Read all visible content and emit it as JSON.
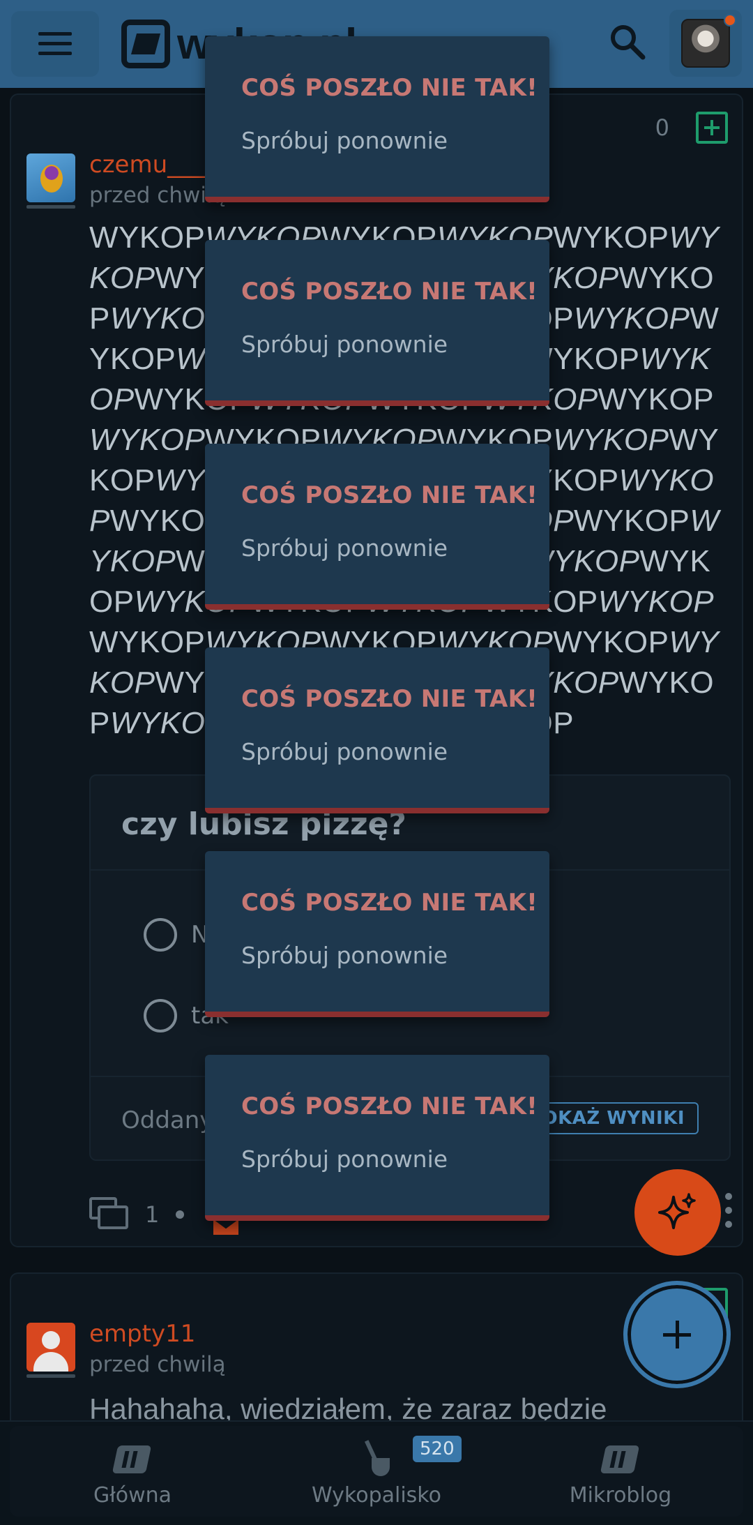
{
  "header": {
    "logo_text": "wykop.pl",
    "avatar_alt": "user-avatar"
  },
  "entries": [
    {
      "author": "czemu____",
      "time": "przed chwilą",
      "votes": "0",
      "text_segments": [
        {
          "t": "WYKOP",
          "i": false
        },
        {
          "t": "WYKOP",
          "i": true
        },
        {
          "t": "WYKOP",
          "i": false
        },
        {
          "t": "WYKOP",
          "i": true
        },
        {
          "t": "WYKOP",
          "i": false
        },
        {
          "t": "WYKOP",
          "i": true
        },
        {
          "t": "WYKOP",
          "i": false
        },
        {
          "t": "WYKOP",
          "i": true
        },
        {
          "t": "WYKOP",
          "i": false
        },
        {
          "t": "WYKOP",
          "i": true
        },
        {
          "t": "WYKOP",
          "i": false
        },
        {
          "t": "WYKOP",
          "i": true
        },
        {
          "t": "WYKOP",
          "i": false
        },
        {
          "t": "WYKOP",
          "i": true
        },
        {
          "t": "WYKOP",
          "i": false
        },
        {
          "t": "WYKOP",
          "i": true
        },
        {
          "t": "WYKOP",
          "i": false
        },
        {
          "t": "WYKOP",
          "i": true
        },
        {
          "t": "WYKOP",
          "i": false
        },
        {
          "t": "WYKOP",
          "i": true
        },
        {
          "t": "WYKOP",
          "i": false
        },
        {
          "t": "WYKOP",
          "i": true
        },
        {
          "t": "WYKOP",
          "i": false
        },
        {
          "t": "WYKOP",
          "i": true
        },
        {
          "t": "WYKOP",
          "i": false
        },
        {
          "t": "WYKOP",
          "i": true
        },
        {
          "t": "WYKOP",
          "i": false
        },
        {
          "t": "WYKOP",
          "i": true
        },
        {
          "t": "WYKOP",
          "i": false
        },
        {
          "t": "WYKOP",
          "i": true
        },
        {
          "t": "WYKOP",
          "i": false
        },
        {
          "t": "WYKOP",
          "i": true
        },
        {
          "t": "WYKOP",
          "i": false
        },
        {
          "t": "WYKOP",
          "i": true
        },
        {
          "t": "WYKOP",
          "i": false
        },
        {
          "t": "WYKOP",
          "i": true
        },
        {
          "t": "WYKOP",
          "i": false
        },
        {
          "t": "WYKOP",
          "i": true
        },
        {
          "t": "WYKOP",
          "i": false
        },
        {
          "t": "WYKOP",
          "i": true
        },
        {
          "t": "WYKOP",
          "i": false
        },
        {
          "t": "WYKOP",
          "i": true
        },
        {
          "t": "WYKOP",
          "i": false
        },
        {
          "t": "WYKOP",
          "i": true
        },
        {
          "t": "WYKOP",
          "i": false
        },
        {
          "t": "WYKOP",
          "i": true
        },
        {
          "t": "WYKOP",
          "i": false
        },
        {
          "t": "WYKOP",
          "i": true
        },
        {
          "t": "WYKOP",
          "i": false
        },
        {
          "t": "WYKOP",
          "i": true
        },
        {
          "t": "WYKOP",
          "i": false
        },
        {
          "t": "WYKOP",
          "i": true
        },
        {
          "t": "WYKOP",
          "i": false
        },
        {
          "t": "WYKOP",
          "i": true
        },
        {
          "t": "WYKOP",
          "i": false
        },
        {
          "t": "WYKOP",
          "i": true
        },
        {
          "t": "WYKOP",
          "i": false
        },
        {
          "t": "WYKOP",
          "i": true
        },
        {
          "t": "WYKOP",
          "i": false
        },
        {
          "t": "WYKOP",
          "i": true
        },
        {
          "t": "WYKOP",
          "i": false
        },
        {
          "t": "WYKOP",
          "i": true
        },
        {
          "t": "WYKOP",
          "i": false
        },
        {
          "t": "WYKOP",
          "i": true
        },
        {
          "t": "WYKOP",
          "i": false
        },
        {
          "t": "WYKOP",
          "i": true
        },
        {
          "t": "WYKOP",
          "i": false
        },
        {
          "t": "WYKOP",
          "i": true
        },
        {
          "t": "WYKOP",
          "i": false
        }
      ],
      "poll": {
        "question": "czy lubisz pizzę?",
        "options": [
          "Nie",
          "tak"
        ],
        "votes_label": "Oddanych głosów: 0",
        "show_results": "POKAŻ WYNIKI"
      },
      "comments": "1"
    },
    {
      "author": "empty11",
      "time": "przed chwilą",
      "text": "Hahahaha, wiedziałem, że zaraz będzie"
    }
  ],
  "toasts": [
    {
      "title": "COŚ POSZŁO NIE TAK!",
      "message": "Spróbuj ponownie"
    },
    {
      "title": "COŚ POSZŁO NIE TAK!",
      "message": "Spróbuj ponownie"
    },
    {
      "title": "COŚ POSZŁO NIE TAK!",
      "message": "Spróbuj ponownie"
    },
    {
      "title": "COŚ POSZŁO NIE TAK!",
      "message": "Spróbuj ponownie"
    },
    {
      "title": "COŚ POSZŁO NIE TAK!",
      "message": "Spróbuj ponownie"
    },
    {
      "title": "COŚ POSZŁO NIE TAK!",
      "message": "Spróbuj ponownie"
    }
  ],
  "bottom_nav": {
    "items": [
      "Główna",
      "Wykopalisko",
      "Mikroblog"
    ],
    "wykopalisko_badge": "520"
  },
  "colors": {
    "header": "#2e5f87",
    "accent_orange": "#d84a18",
    "toast_bg": "#1e384e",
    "toast_title": "#c77874",
    "toast_border": "#8a2f2f",
    "vote_green": "#1e9c6c"
  },
  "icons": [
    "menu-icon",
    "search-icon",
    "plus-square-icon",
    "comment-icon",
    "favorite-icon",
    "more-icon",
    "sparkle-icon",
    "plus-icon",
    "home-logo-icon",
    "shovel-icon",
    "microblog-logo-icon"
  ]
}
